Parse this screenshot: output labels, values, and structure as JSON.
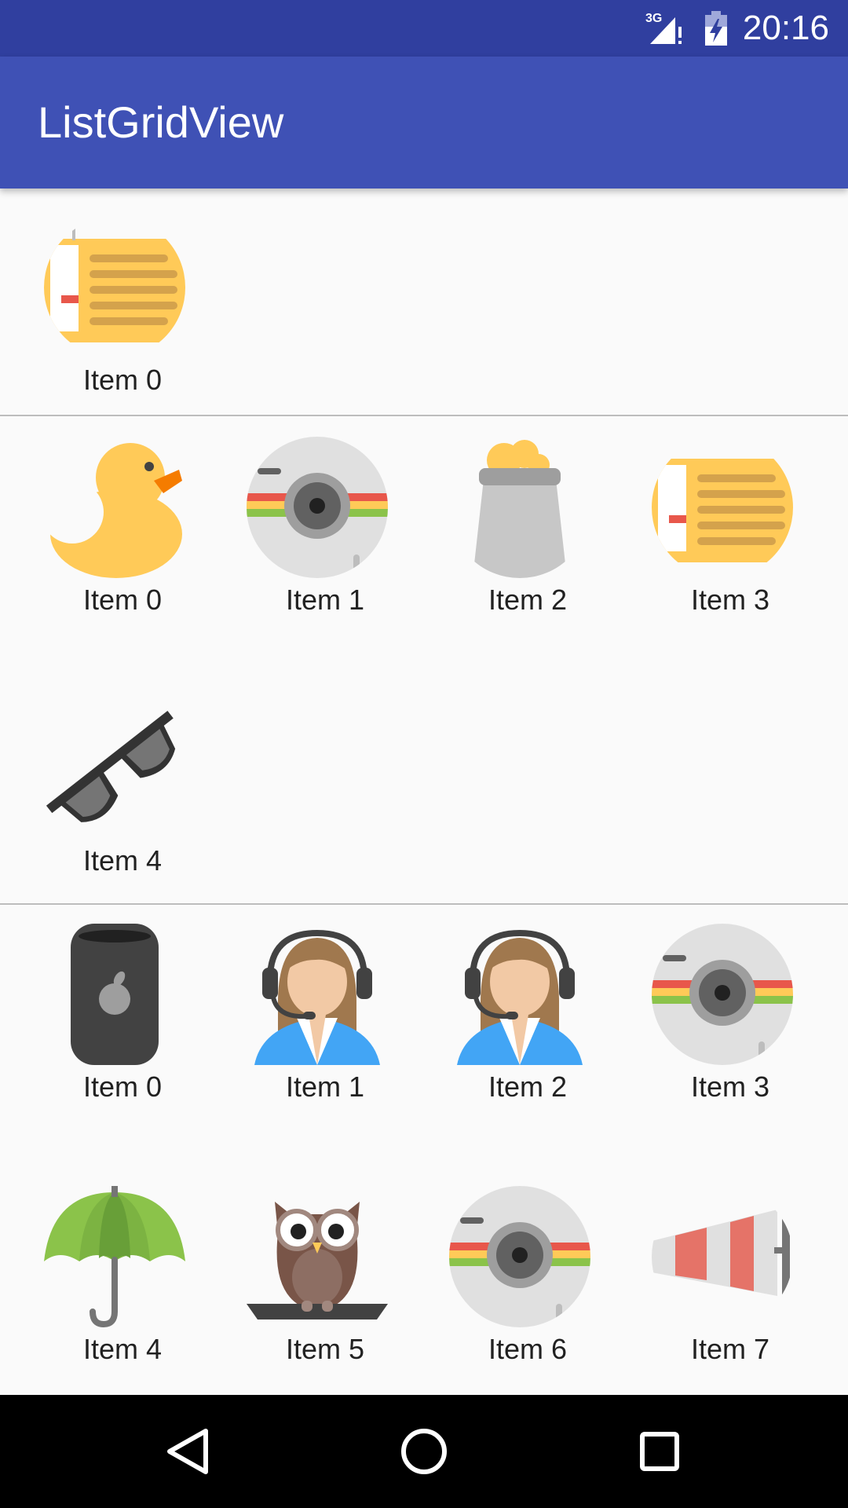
{
  "status_bar": {
    "network": "3G",
    "time": "20:16"
  },
  "app_bar": {
    "title": "ListGridView"
  },
  "sections": [
    {
      "items": [
        {
          "label": "Item 0",
          "icon": "radio-icon"
        }
      ]
    },
    {
      "items": [
        {
          "label": "Item 0",
          "icon": "duck-icon"
        },
        {
          "label": "Item 1",
          "icon": "camera-icon"
        },
        {
          "label": "Item 2",
          "icon": "beer-jar-icon"
        },
        {
          "label": "Item 3",
          "icon": "radio-icon"
        },
        {
          "label": "Item 4",
          "icon": "sunglasses-icon"
        }
      ]
    },
    {
      "items": [
        {
          "label": "Item 0",
          "icon": "mac-pro-icon"
        },
        {
          "label": "Item 1",
          "icon": "support-agent-icon"
        },
        {
          "label": "Item 2",
          "icon": "support-agent-icon"
        },
        {
          "label": "Item 3",
          "icon": "camera-icon"
        },
        {
          "label": "Item 4",
          "icon": "umbrella-icon"
        },
        {
          "label": "Item 5",
          "icon": "owl-icon"
        },
        {
          "label": "Item 6",
          "icon": "camera-icon"
        },
        {
          "label": "Item 7",
          "icon": "windsock-icon"
        }
      ]
    }
  ],
  "nav_bar": {
    "back": "back-icon",
    "home": "home-icon",
    "recents": "recents-icon"
  }
}
